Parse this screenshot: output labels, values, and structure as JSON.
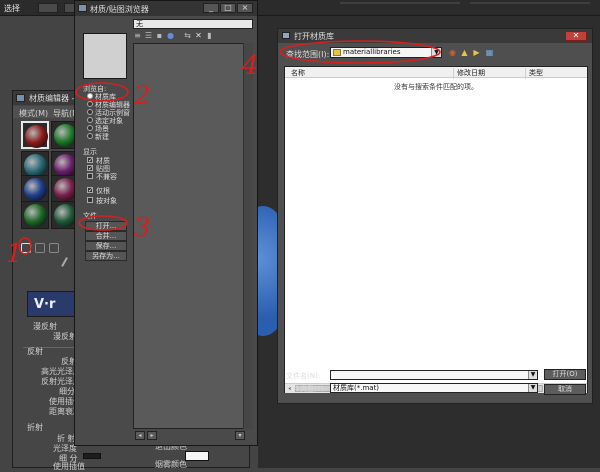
{
  "top_bar": {
    "label": "选择"
  },
  "material_editor": {
    "title": "材质编辑器 - ",
    "menu": [
      "模式(M)",
      "导航(N)"
    ],
    "slot_colors": [
      "#8a1d1d",
      "#1f7a2a",
      "#2a6a78",
      "#6a1f6a",
      "#1f3f8a",
      "#7a1f4a",
      "#1f6a2a",
      "#1f5a3a"
    ],
    "vray_text": "V·r",
    "labels": {
      "diffuse_group": "漫反射",
      "diffuse": "漫反射",
      "reflect_group": "反射",
      "reflect": "反射",
      "hilight_gloss": "高光光泽度",
      "refl_gloss": "反射光泽度",
      "subdivs": "细分",
      "use_interp": "使用插值",
      "dim_distance": "距离衰减",
      "refract_group": "折射",
      "refract": "折 射",
      "gloss": "光泽度",
      "subdivs2": "细 分",
      "use_interp2": "使用插值",
      "exit_color": "退出颜色",
      "fog_color": "烟雾颜色"
    }
  },
  "material_browser": {
    "title": "材质/贴图浏览器",
    "search_value": "无",
    "browse_from_title": "浏览自:",
    "browse_from": [
      {
        "label": "材质库",
        "selected": true
      },
      {
        "label": "材质编辑器",
        "selected": false
      },
      {
        "label": "活动示例窗",
        "selected": false
      },
      {
        "label": "选定对象",
        "selected": false
      },
      {
        "label": "场景",
        "selected": false
      },
      {
        "label": "新建",
        "selected": false
      }
    ],
    "show_title": "显示",
    "show": [
      {
        "label": "材质",
        "checked": true
      },
      {
        "label": "贴图",
        "checked": true
      },
      {
        "label": "不兼容",
        "checked": false
      }
    ],
    "show2": [
      {
        "label": "仅根",
        "checked": true
      },
      {
        "label": "按对象",
        "checked": false
      }
    ],
    "file_title": "文件",
    "file_buttons": [
      "打开...",
      "合并...",
      "保存...",
      "另存为..."
    ]
  },
  "open_dialog": {
    "title": "打开材质库",
    "look_in_label": "查找范围(I):",
    "look_in_value": "materiallibraries",
    "columns": [
      "名称",
      "修改日期",
      "类型"
    ],
    "empty_message": "没有与搜索条件匹配的项。",
    "file_name_label": "文件名(N):",
    "file_name_value": "",
    "file_type_label": "文件类型(T):",
    "file_type_value": "材质库(*.mat)",
    "open_button": "打开(O)",
    "cancel_button": "取消"
  },
  "annotations": [
    "1",
    "2",
    "3",
    "4"
  ],
  "colors": {
    "annotation_red": "#d42020",
    "close_red": "#c2413a"
  }
}
